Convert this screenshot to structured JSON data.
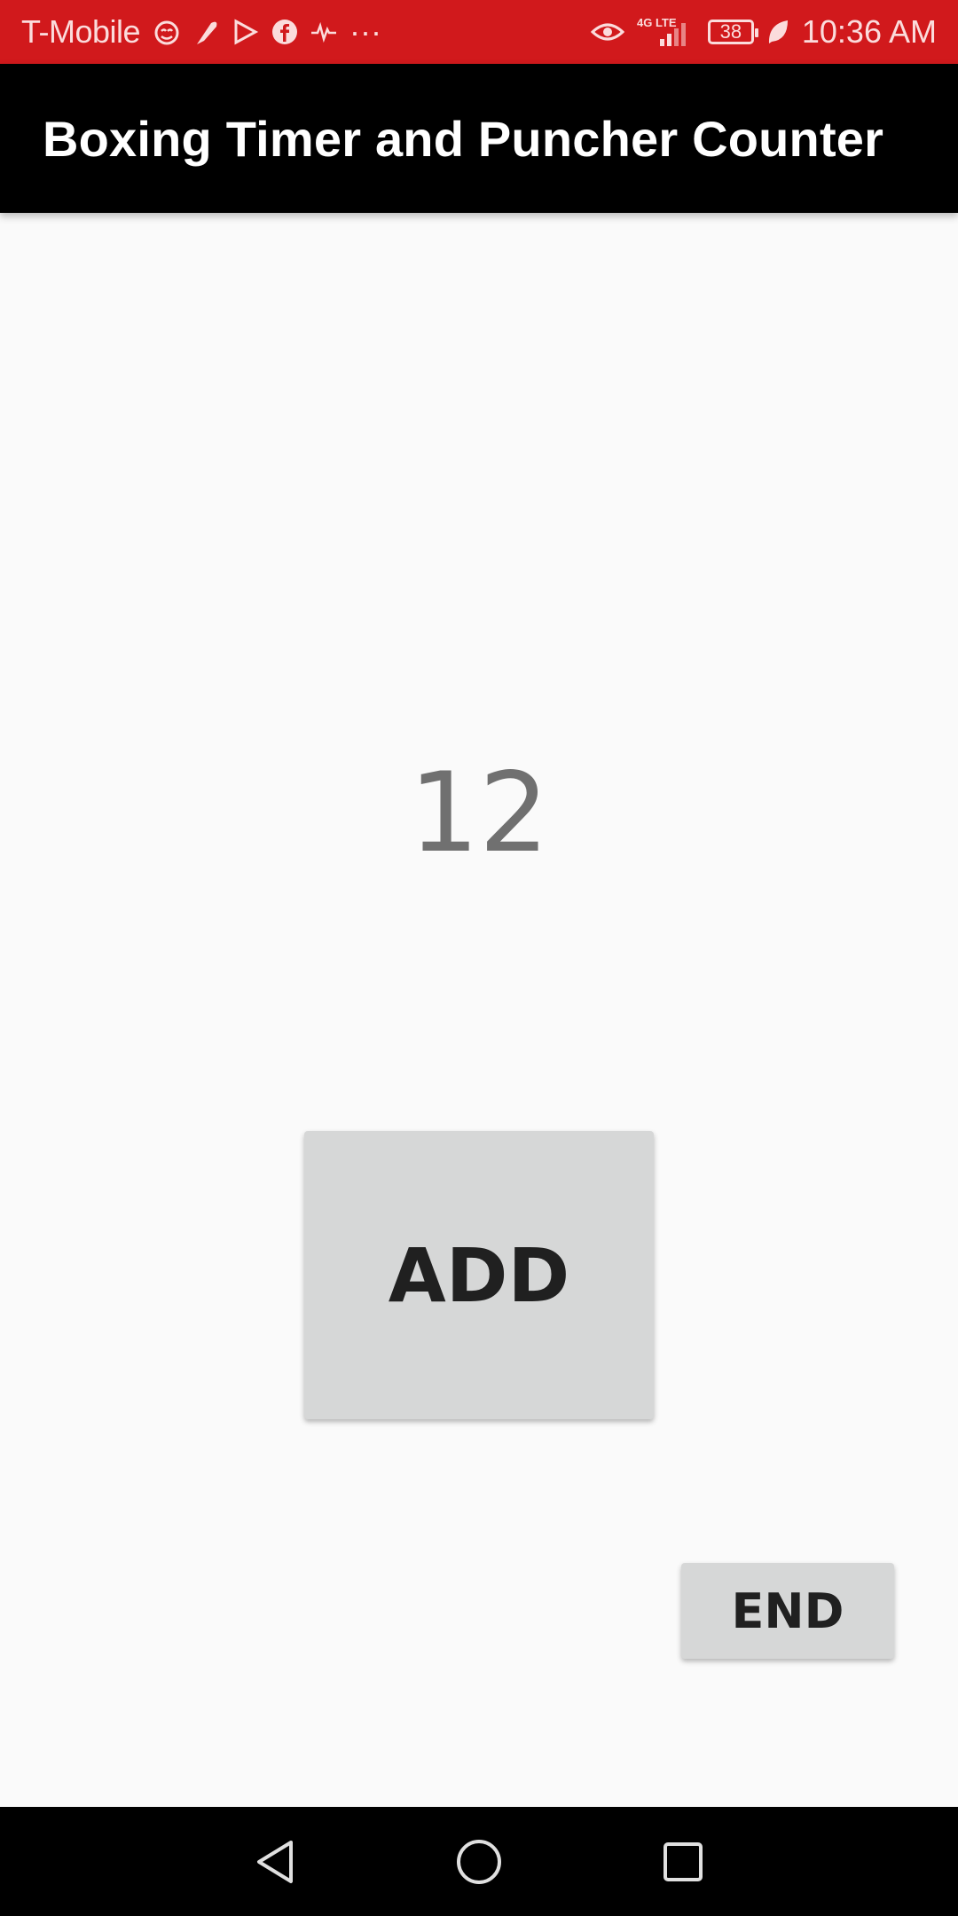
{
  "status_bar": {
    "carrier": "T-Mobile",
    "network": "4G LTE",
    "battery": "38",
    "time": "10:36 AM",
    "overflow": "···",
    "icons_left": [
      "cat-face-icon",
      "feather-icon",
      "play-store-icon",
      "facebook-icon",
      "pulse-icon"
    ],
    "icons_right": [
      "eye-icon",
      "signal-icon",
      "battery-icon",
      "leaf-icon"
    ]
  },
  "app_bar": {
    "title": "Boxing Timer and Puncher Counter"
  },
  "counter": {
    "value": "12"
  },
  "buttons": {
    "add": "ADD",
    "end": "END"
  },
  "nav_bar": {
    "items": [
      "back-icon",
      "home-icon",
      "recents-icon"
    ]
  },
  "colors": {
    "status_bar": "#d1191c",
    "app_bar": "#000000",
    "background": "#fafafa",
    "button": "#d6d7d7",
    "counter_text": "#707070"
  }
}
